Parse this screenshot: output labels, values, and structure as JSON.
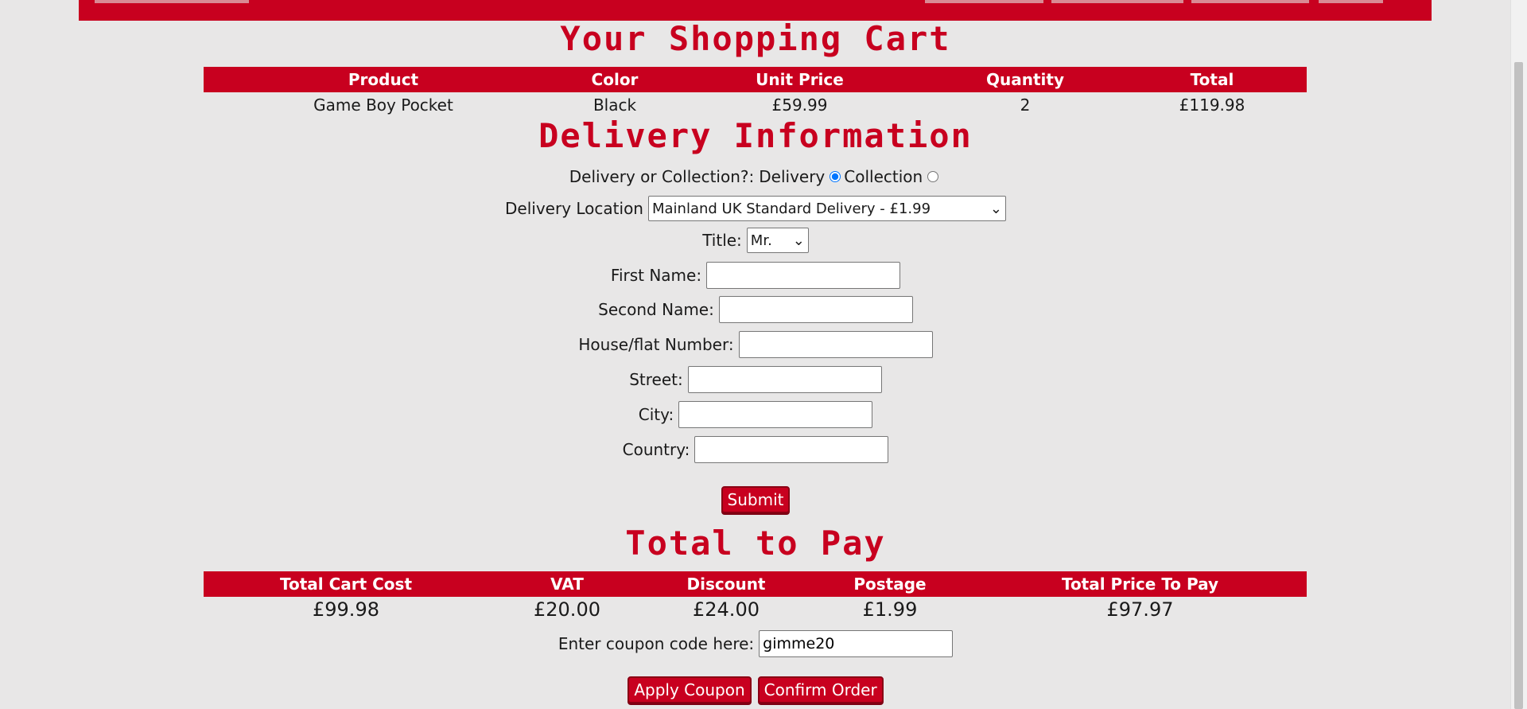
{
  "cart": {
    "heading": "Your Shopping Cart",
    "headers": [
      "Product",
      "Color",
      "Unit Price",
      "Quantity",
      "Total"
    ],
    "rows": [
      [
        "Game Boy Pocket",
        "Black",
        "£59.99",
        "2",
        "£119.98"
      ]
    ]
  },
  "delivery": {
    "heading": "Delivery Information",
    "method_label": "Delivery or Collection?:",
    "option_delivery": "Delivery",
    "option_collection": "Collection",
    "location_label": "Delivery Location",
    "location_value": "Mainland UK Standard Delivery - £1.99",
    "title_label": "Title:",
    "title_value": "Mr.",
    "first_name_label": "First Name:",
    "second_name_label": "Second Name:",
    "house_label": "House/flat Number:",
    "street_label": "Street:",
    "city_label": "City:",
    "country_label": "Country:",
    "submit_label": "Submit"
  },
  "totals": {
    "heading": "Total to Pay",
    "headers": [
      "Total Cart Cost",
      "VAT",
      "Discount",
      "Postage",
      "Total Price To Pay"
    ],
    "values": [
      "£99.98",
      "£20.00",
      "£24.00",
      "£1.99",
      "£97.97"
    ],
    "coupon_label": "Enter coupon code here:",
    "coupon_value": "gimme20",
    "apply_label": "Apply Coupon",
    "confirm_label": "Confirm Order"
  },
  "colors": {
    "accent": "#c8001f",
    "background": "#e8e7e7"
  }
}
